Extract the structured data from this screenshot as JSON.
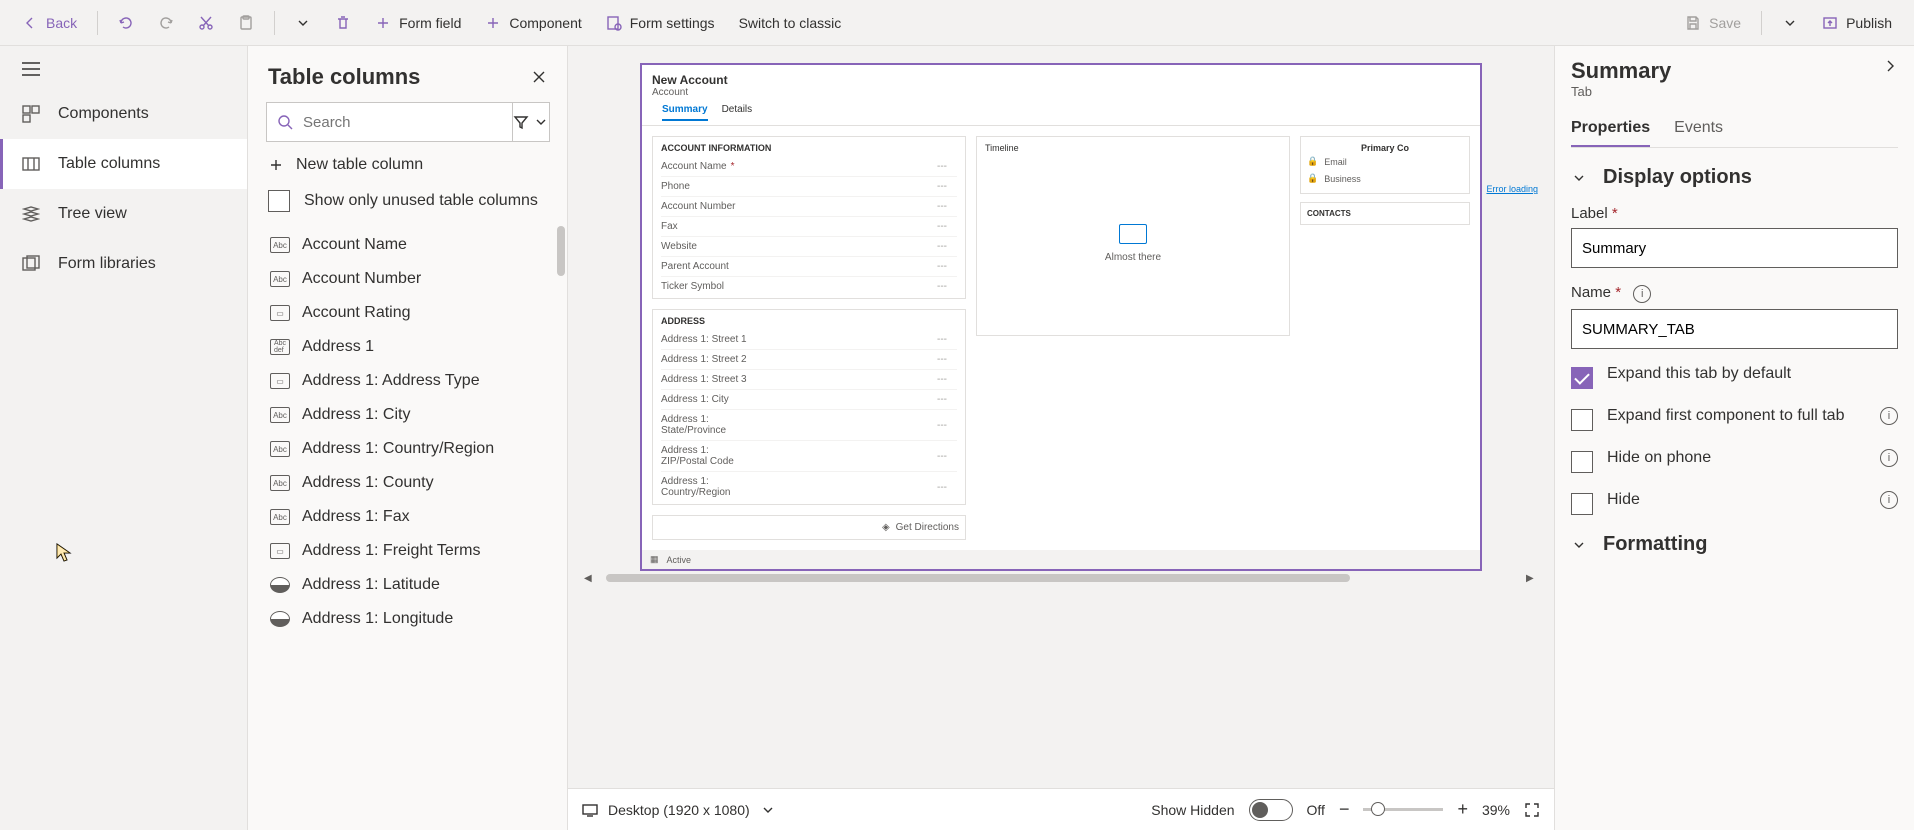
{
  "toolbar": {
    "back": "Back",
    "form_field": "Form field",
    "component": "Component",
    "form_settings": "Form settings",
    "switch_classic": "Switch to classic",
    "save": "Save",
    "publish": "Publish"
  },
  "left_nav": {
    "items": [
      {
        "label": "Components"
      },
      {
        "label": "Table columns"
      },
      {
        "label": "Tree view"
      },
      {
        "label": "Form libraries"
      }
    ]
  },
  "columns_panel": {
    "title": "Table columns",
    "search_placeholder": "Search",
    "new_column": "New table column",
    "show_unused": "Show only unused table columns",
    "items": [
      "Account Name",
      "Account Number",
      "Account Rating",
      "Address 1",
      "Address 1: Address Type",
      "Address 1: City",
      "Address 1: Country/Region",
      "Address 1: County",
      "Address 1: Fax",
      "Address 1: Freight Terms",
      "Address 1: Latitude",
      "Address 1: Longitude"
    ]
  },
  "preview": {
    "record_title": "New Account",
    "record_subtitle": "Account",
    "tabs": [
      "Summary",
      "Details"
    ],
    "section_account": "ACCOUNT INFORMATION",
    "section_address": "ADDRESS",
    "timeline_title": "Timeline",
    "timeline_status": "Almost there",
    "loading": "Error loading",
    "account_fields": [
      {
        "label": "Account Name",
        "required": true
      },
      {
        "label": "Phone"
      },
      {
        "label": "Account Number"
      },
      {
        "label": "Fax"
      },
      {
        "label": "Website"
      },
      {
        "label": "Parent Account"
      },
      {
        "label": "Ticker Symbol"
      }
    ],
    "address_fields": [
      {
        "label": "Address 1: Street 1"
      },
      {
        "label": "Address 1: Street 2"
      },
      {
        "label": "Address 1: Street 3"
      },
      {
        "label": "Address 1: City"
      },
      {
        "label": "Address 1: State/Province"
      },
      {
        "label": "Address 1: ZIP/Postal Code"
      },
      {
        "label": "Address 1: Country/Region"
      }
    ],
    "get_directions": "Get Directions",
    "side_primary": "Primary Co",
    "side_email": "Email",
    "side_business": "Business",
    "side_contacts": "CONTACTS",
    "status_active": "Active"
  },
  "canvas_footer": {
    "device": "Desktop (1920 x 1080)",
    "show_hidden": "Show Hidden",
    "toggle_state": "Off",
    "zoom": "39%"
  },
  "properties": {
    "title": "Summary",
    "subtitle": "Tab",
    "tabs": [
      "Properties",
      "Events"
    ],
    "section_display": "Display options",
    "label_field": "Label",
    "label_value": "Summary",
    "name_field": "Name",
    "name_value": "SUMMARY_TAB",
    "expand_default": "Expand this tab by default",
    "expand_first": "Expand first component to full tab",
    "hide_phone": "Hide on phone",
    "hide": "Hide",
    "section_formatting": "Formatting"
  }
}
